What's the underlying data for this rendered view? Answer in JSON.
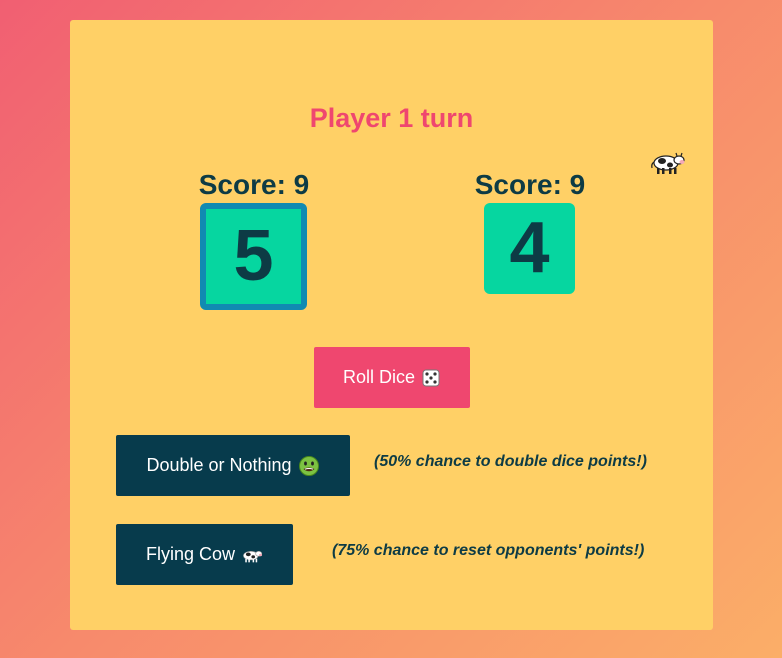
{
  "game": {
    "turn_text": "Player 1 turn",
    "active_player": 1,
    "cow_indicator_icon": "cow-icon"
  },
  "players": [
    {
      "score_text": "Score: 9",
      "die_value": "5",
      "active": true
    },
    {
      "score_text": "Score: 9",
      "die_value": "4",
      "active": false
    }
  ],
  "actions": {
    "roll": {
      "label": "Roll Dice",
      "icon": "die-icon"
    },
    "double": {
      "label": "Double or Nothing",
      "icon": "nauseated-face-icon",
      "hint": "(50% chance to double dice points!)"
    },
    "cow": {
      "label": "Flying Cow",
      "icon": "cow-icon",
      "hint": "(75% chance to reset opponents' points!)"
    }
  },
  "colors": {
    "card_background": "#ffd066",
    "accent_pink": "#ef476f",
    "die_green": "#06d6a0",
    "active_die_border": "#118ab2",
    "dark_button": "#073b4c",
    "text_dark": "#0d3b45"
  }
}
